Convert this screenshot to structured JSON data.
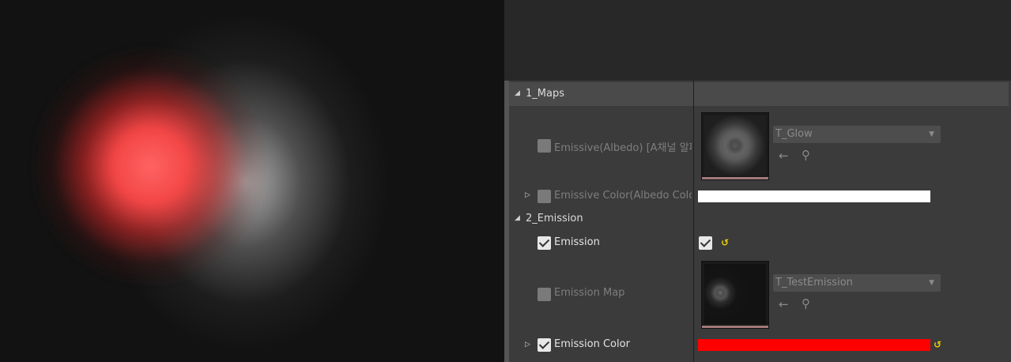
{
  "categories": {
    "maps": "1_Maps",
    "emission": "2_Emission"
  },
  "properties": {
    "emissive_albedo": {
      "label": "Emissive(Albedo) [A채널 알파",
      "texture_name": "T_Glow",
      "checked": false
    },
    "emissive_color": {
      "label": "Emissive Color(Albedo Colo",
      "color": "#ffffff",
      "checked": false
    },
    "emission": {
      "label": "Emission",
      "checked": true,
      "value_checked": true
    },
    "emission_map": {
      "label": "Emission Map",
      "texture_name": "T_TestEmission",
      "checked": false
    },
    "emission_color": {
      "label": "Emission Color",
      "color": "#ff0000",
      "checked": true
    }
  },
  "icons": {
    "expand": "▷",
    "collapse": "◢",
    "dropdown": "▼",
    "use_asset": "←",
    "browse": "⚲",
    "reset": "↺"
  },
  "colors": {
    "panel_bg": "#3b3b3b",
    "header_bg": "#4a4a4a",
    "reset_arrow": "#e8d000"
  }
}
